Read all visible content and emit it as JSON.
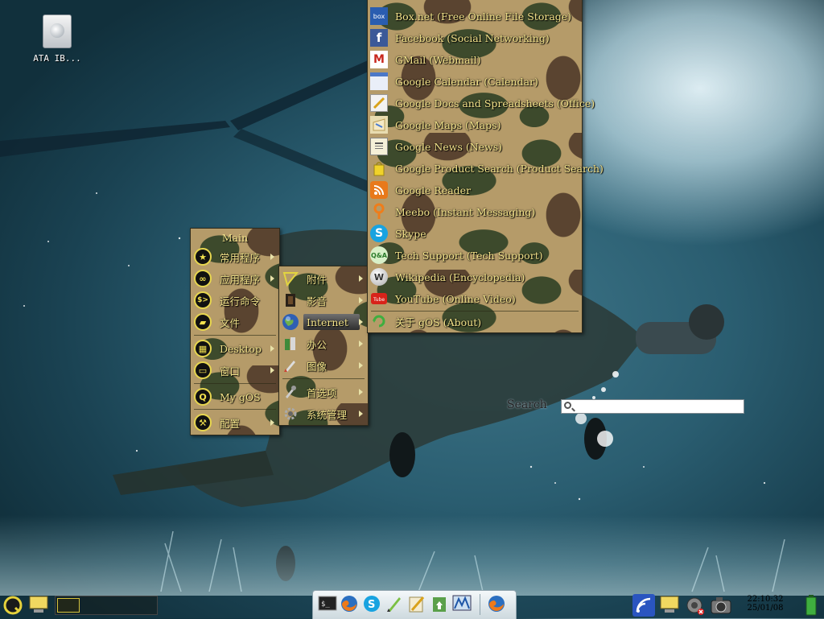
{
  "desktop": {
    "icons": [
      {
        "label": "ATA IB..."
      }
    ]
  },
  "main_menu": {
    "title": "Main",
    "items": [
      {
        "label": "常用程序",
        "icon": "star-icon",
        "glyph": "★"
      },
      {
        "label": "应用程序",
        "icon": "apps-icon",
        "glyph": "∞"
      },
      {
        "label": "运行命令",
        "icon": "run-command-icon",
        "glyph": "$>"
      },
      {
        "label": "文件",
        "icon": "folder-icon",
        "glyph": "▰"
      },
      {
        "label": "Desktop",
        "icon": "desktop-icon",
        "glyph": "▦"
      },
      {
        "label": "窗口",
        "icon": "window-icon",
        "glyph": "▭"
      },
      {
        "label": "My gOS",
        "icon": "gos-icon",
        "glyph": "Q"
      },
      {
        "label": "配置",
        "icon": "wrench-icon",
        "glyph": "⚒"
      }
    ]
  },
  "sub_menu": {
    "items": [
      {
        "label": "附件",
        "icon": "accessories-icon"
      },
      {
        "label": "影音",
        "icon": "multimedia-icon"
      },
      {
        "label": "Internet",
        "icon": "globe-icon"
      },
      {
        "label": "办公",
        "icon": "office-icon"
      },
      {
        "label": "图像",
        "icon": "graphics-icon"
      },
      {
        "label": "首选项",
        "icon": "preferences-icon"
      },
      {
        "label": "系统管理",
        "icon": "system-admin-icon"
      }
    ]
  },
  "internet_menu": {
    "items": [
      {
        "label": "Box.net (Free Online File Storage)",
        "icon": "boxnet-icon"
      },
      {
        "label": "Facebook (Social Networking)",
        "icon": "facebook-icon"
      },
      {
        "label": "GMail (Webmail)",
        "icon": "gmail-icon"
      },
      {
        "label": "Google Calendar (Calendar)",
        "icon": "calendar-icon"
      },
      {
        "label": "Google Docs and Spreadsheets (Office)",
        "icon": "docs-icon"
      },
      {
        "label": "Google Maps (Maps)",
        "icon": "maps-icon"
      },
      {
        "label": "Google News (News)",
        "icon": "news-icon"
      },
      {
        "label": "Google Product Search (Product Search)",
        "icon": "shopping-icon"
      },
      {
        "label": "Google Reader",
        "icon": "rss-icon"
      },
      {
        "label": "Meebo (Instant Messaging)",
        "icon": "meebo-icon"
      },
      {
        "label": "Skype",
        "icon": "skype-icon"
      },
      {
        "label": "Tech Support (Tech Support)",
        "icon": "qa-icon"
      },
      {
        "label": "Wikipedia (Encyclopedia)",
        "icon": "wikipedia-icon"
      },
      {
        "label": "YouTube (Online Video)",
        "icon": "youtube-icon"
      },
      {
        "label": "关于 gOS (About)",
        "icon": "about-icon"
      }
    ]
  },
  "search": {
    "label": "Search",
    "value": ""
  },
  "taskbar": {
    "clock_time": "22:10:32",
    "clock_date": "25/01/08",
    "dock_icons": [
      "terminal-icon",
      "firefox-icon",
      "skype-icon",
      "text-editor-icon",
      "office-icon",
      "file-manager-icon",
      "monitor-icon",
      "firefox-icon"
    ]
  },
  "colors": {
    "menu_text": "#f3e38a",
    "camo_base": "#b59b69"
  }
}
